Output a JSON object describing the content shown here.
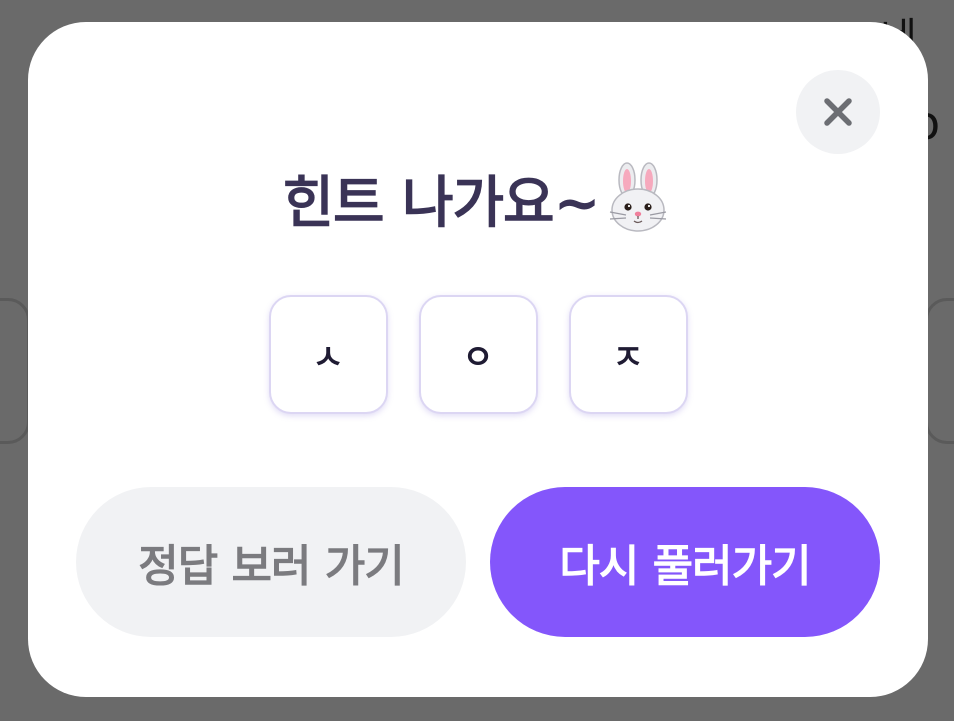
{
  "background": {
    "partial_text_top": "네",
    "partial_text_right": "o"
  },
  "modal": {
    "title": "힌트 나가요~",
    "title_emoji": "rabbit-face-emoji",
    "close_icon": "close-icon",
    "hints": [
      "ㅅ",
      "ㅇ",
      "ㅈ"
    ],
    "buttons": {
      "answer_label": "정답 보러 가기",
      "retry_label": "다시 풀러가기"
    }
  },
  "colors": {
    "overlay": "#6a6a6a",
    "title": "#3a3356",
    "primary": "#8456fb",
    "secondary_bg": "#f1f2f4",
    "secondary_text": "#7b7b7f",
    "hint_border": "#dcd6f3"
  }
}
